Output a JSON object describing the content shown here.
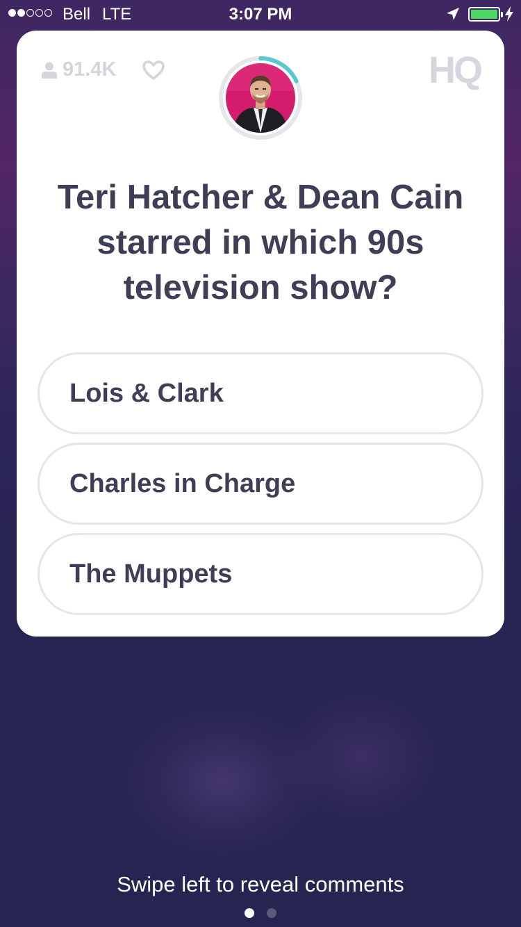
{
  "status_bar": {
    "carrier": "Bell",
    "network": "LTE",
    "time": "3:07 PM",
    "signal_bars_filled": 2,
    "signal_bars_total": 5,
    "battery_color": "#4cd964"
  },
  "card": {
    "viewer_count": "91.4K",
    "viewer_icon": "person-icon",
    "like_icon": "heart-icon",
    "logo": "HQ",
    "timer_color": "#5bc8d0",
    "timer_progress": 0.18,
    "question": "Teri Hatcher & Dean Cain starred in which 90s television show?",
    "answers": [
      {
        "label": "Lois & Clark"
      },
      {
        "label": "Charles in Charge"
      },
      {
        "label": "The Muppets"
      }
    ]
  },
  "footer": {
    "swipe_hint": "Swipe left to reveal comments",
    "page_index": 1,
    "page_count": 2
  }
}
